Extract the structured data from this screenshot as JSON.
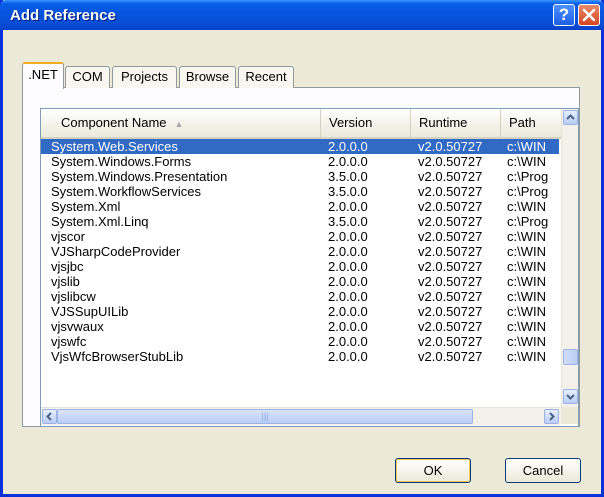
{
  "window": {
    "title": "Add Reference"
  },
  "tabs": [
    ".NET",
    "COM",
    "Projects",
    "Browse",
    "Recent"
  ],
  "columns": [
    "Component Name",
    "Version",
    "Runtime",
    "Path"
  ],
  "rows": [
    [
      "System.Web.Services",
      "2.0.0.0",
      "v2.0.50727",
      "c:\\WIN"
    ],
    [
      "System.Windows.Forms",
      "2.0.0.0",
      "v2.0.50727",
      "c:\\WIN"
    ],
    [
      "System.Windows.Presentation",
      "3.5.0.0",
      "v2.0.50727",
      "c:\\Prog"
    ],
    [
      "System.WorkflowServices",
      "3.5.0.0",
      "v2.0.50727",
      "c:\\Prog"
    ],
    [
      "System.Xml",
      "2.0.0.0",
      "v2.0.50727",
      "c:\\WIN"
    ],
    [
      "System.Xml.Linq",
      "3.5.0.0",
      "v2.0.50727",
      "c:\\Prog"
    ],
    [
      "vjscor",
      "2.0.0.0",
      "v2.0.50727",
      "c:\\WIN"
    ],
    [
      "VJSharpCodeProvider",
      "2.0.0.0",
      "v2.0.50727",
      "c:\\WIN"
    ],
    [
      "vjsjbc",
      "2.0.0.0",
      "v2.0.50727",
      "c:\\WIN"
    ],
    [
      "vjslib",
      "2.0.0.0",
      "v2.0.50727",
      "c:\\WIN"
    ],
    [
      "vjslibcw",
      "2.0.0.0",
      "v2.0.50727",
      "c:\\WIN"
    ],
    [
      "VJSSupUILib",
      "2.0.0.0",
      "v2.0.50727",
      "c:\\WIN"
    ],
    [
      "vjsvwaux",
      "2.0.0.0",
      "v2.0.50727",
      "c:\\WIN"
    ],
    [
      "vjswfc",
      "2.0.0.0",
      "v2.0.50727",
      "c:\\WIN"
    ],
    [
      "VjsWfcBrowserStubLib",
      "2.0.0.0",
      "v2.0.50727",
      "c:\\WIN"
    ]
  ],
  "selected_row": 0,
  "buttons": {
    "ok": "OK",
    "cancel": "Cancel"
  },
  "icons": {
    "help": "help-icon",
    "close": "close-icon",
    "sort": "sort-ascending-icon"
  },
  "colors": {
    "titlebar": "#0555e0",
    "selection": "#316ac5",
    "dialog_bg": "#ece9d8"
  }
}
